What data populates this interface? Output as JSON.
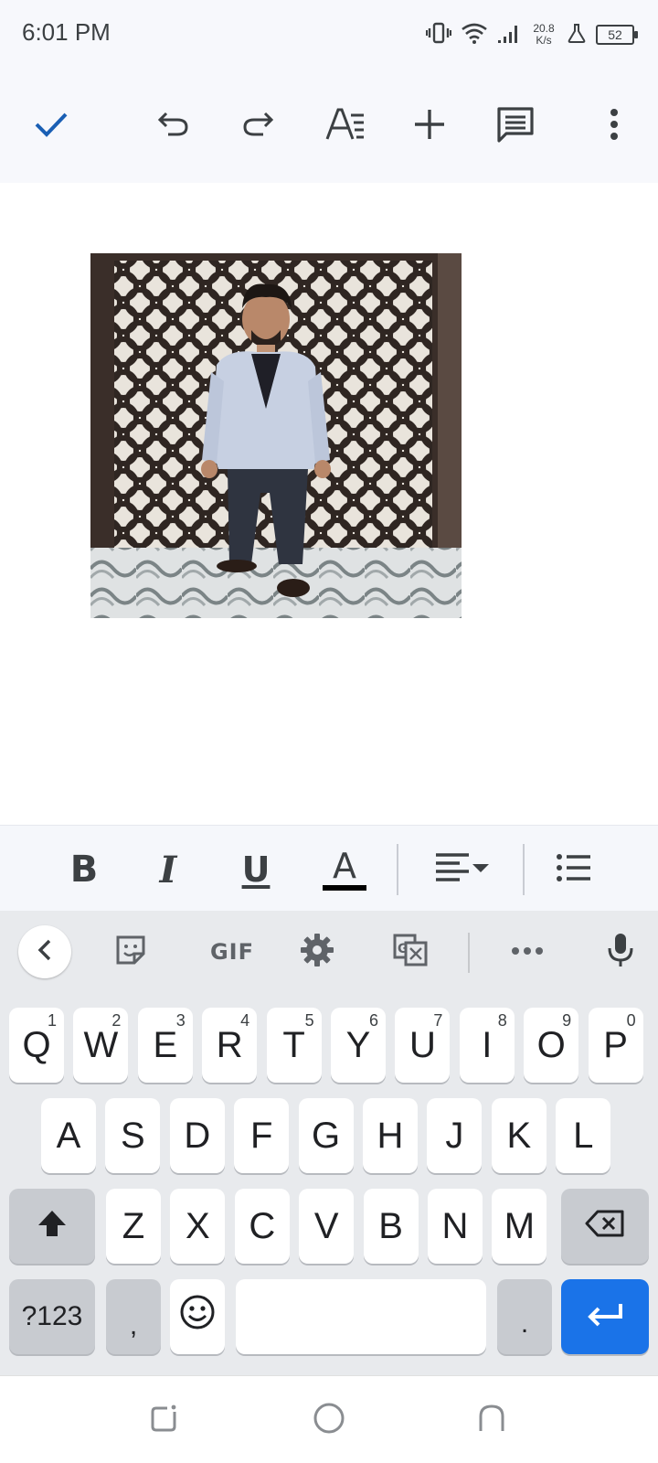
{
  "status_bar": {
    "time": "6:01 PM",
    "net_speed_value": "20.8",
    "net_speed_unit": "K/s",
    "battery": "52",
    "icons": [
      "vibrate-icon",
      "wifi-icon",
      "signal-icon",
      "flask-icon",
      "battery-icon"
    ]
  },
  "toolbar": {
    "icons": [
      "check-icon",
      "undo-icon",
      "redo-icon",
      "text-format-icon",
      "insert-icon",
      "comment-icon",
      "more-vert-icon"
    ],
    "accent_color": "#1a5fb4"
  },
  "document": {
    "image": "photo of a man in a light blazer standing in front of a patterned screen"
  },
  "format_bar": {
    "bold_label": "B",
    "italic_label": "I",
    "underline_label": "U",
    "text_color_label": "A",
    "text_color": "#000000",
    "icons": [
      "align-left-icon",
      "dropdown-arrow-icon",
      "bulleted-list-icon"
    ]
  },
  "keyboard": {
    "toolbar": {
      "gif_label": "GIF",
      "icons": [
        "back-icon",
        "sticker-icon",
        "settings-icon",
        "translate-icon",
        "more-horiz-icon",
        "mic-icon"
      ]
    },
    "row1": [
      {
        "key": "Q",
        "hint": "1"
      },
      {
        "key": "W",
        "hint": "2"
      },
      {
        "key": "E",
        "hint": "3"
      },
      {
        "key": "R",
        "hint": "4"
      },
      {
        "key": "T",
        "hint": "5"
      },
      {
        "key": "Y",
        "hint": "6"
      },
      {
        "key": "U",
        "hint": "7"
      },
      {
        "key": "I",
        "hint": "8"
      },
      {
        "key": "O",
        "hint": "9"
      },
      {
        "key": "P",
        "hint": "0"
      }
    ],
    "row2": [
      "A",
      "S",
      "D",
      "F",
      "G",
      "H",
      "J",
      "K",
      "L"
    ],
    "row3": [
      "Z",
      "X",
      "C",
      "V",
      "B",
      "N",
      "M"
    ],
    "row4": {
      "symbols_label": "?123",
      "comma_label": ",",
      "period_label": "."
    },
    "enter_color": "#1a73e8"
  },
  "nav_bar": {
    "icons": [
      "recents-icon",
      "home-icon",
      "back-icon"
    ]
  }
}
